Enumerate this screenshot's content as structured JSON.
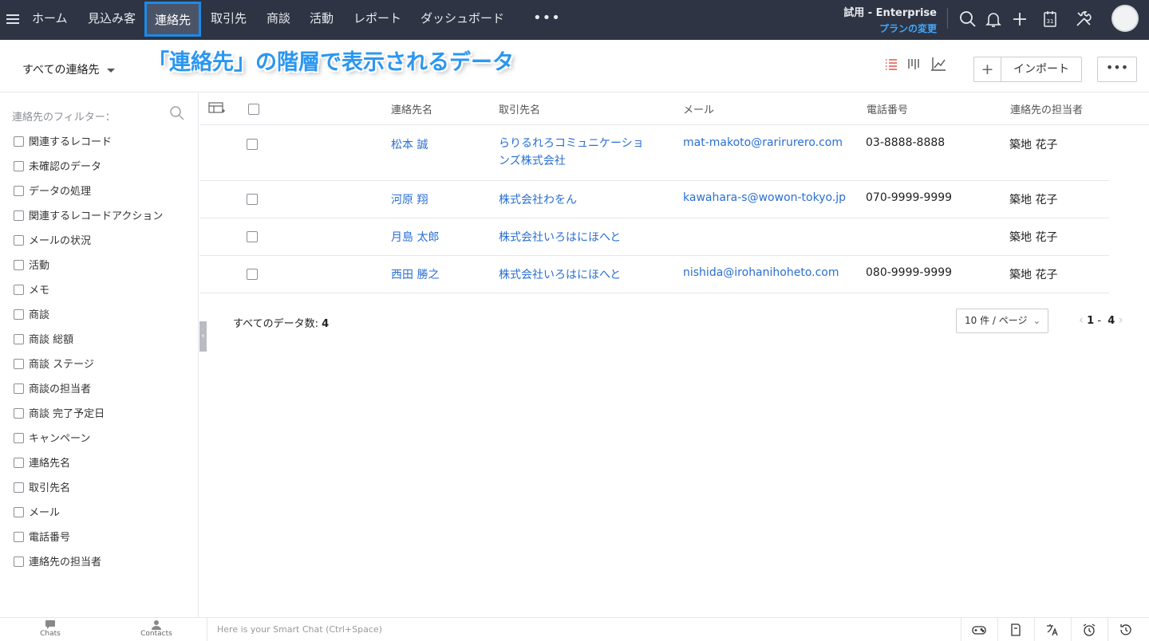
{
  "nav": {
    "items": [
      {
        "label": "ホーム"
      },
      {
        "label": "見込み客"
      },
      {
        "label": "連絡先",
        "active": true
      },
      {
        "label": "取引先"
      },
      {
        "label": "商談"
      },
      {
        "label": "活動"
      },
      {
        "label": "レポート"
      },
      {
        "label": "ダッシュボード"
      }
    ],
    "more": "•••",
    "plan_name": "試用 - Enterprise",
    "plan_link": "プランの変更",
    "icons": [
      "search-icon",
      "bell-icon",
      "plus-icon",
      "calendar-icon",
      "tools-icon"
    ],
    "calendar_day": "31",
    "accent_color": "#1a8bea",
    "bg_color": "#2e3443"
  },
  "toolbar": {
    "view_label": "すべての連絡先",
    "annotation": "「連絡先」の階層で表示されるデータ",
    "plus_label": "+",
    "import_label": "インポート",
    "more_label": "•••",
    "view_icons": [
      "list-view-icon",
      "kanban-view-icon",
      "chart-view-icon"
    ]
  },
  "sidebar": {
    "title": "連絡先のフィルター：",
    "filters": [
      {
        "label": "関連するレコード"
      },
      {
        "label": "未確認のデータ"
      },
      {
        "label": "データの処理"
      },
      {
        "label": "関連するレコードアクション"
      },
      {
        "label": "メールの状況"
      },
      {
        "label": "活動"
      },
      {
        "label": "メモ"
      },
      {
        "label": "商談"
      },
      {
        "label": "商談 総額"
      },
      {
        "label": "商談 ステージ"
      },
      {
        "label": "商談の担当者"
      },
      {
        "label": "商談 完了予定日"
      },
      {
        "label": "キャンペーン"
      },
      {
        "label": "連絡先名"
      },
      {
        "label": "取引先名"
      },
      {
        "label": "メール"
      },
      {
        "label": "電話番号"
      },
      {
        "label": "連絡先の担当者"
      }
    ]
  },
  "table": {
    "columns": {
      "name": "連絡先名",
      "account": "取引先名",
      "email": "メール",
      "phone": "電話番号",
      "owner": "連絡先の担当者"
    },
    "rows": [
      {
        "name": "松本 誠",
        "account": "らりるれろコミュニケーションズ株式会社",
        "email": "mat-makoto@rarirurero.com",
        "phone": "03-8888-8888",
        "owner": "築地 花子"
      },
      {
        "name": "河原 翔",
        "account": "株式会社わをん",
        "email": "kawahara-s@wowon-tokyo.jp",
        "phone": "070-9999-9999",
        "owner": "築地 花子"
      },
      {
        "name": "月島 太郎",
        "account": "株式会社いろはにほへと",
        "email": "",
        "phone": "",
        "owner": "築地 花子"
      },
      {
        "name": "西田 勝之",
        "account": "株式会社いろはにほへと",
        "email": "nishida@irohanihoheto.com",
        "phone": "080-9999-9999",
        "owner": "築地 花子"
      }
    ],
    "link_color": "#2a6fd1"
  },
  "footer": {
    "total_label": "すべてのデータ数:",
    "total_count": "4",
    "per_page": "10 件 / ページ",
    "page_from": "1",
    "page_sep": "-",
    "page_to": "4"
  },
  "bottombar": {
    "chats": "Chats",
    "contacts": "Contacts",
    "smartchat_placeholder": "Here is your Smart Chat (Ctrl+Space)",
    "tools": [
      "gamepad-icon",
      "notes-icon",
      "translate-icon",
      "alarm-icon",
      "history-icon"
    ]
  }
}
